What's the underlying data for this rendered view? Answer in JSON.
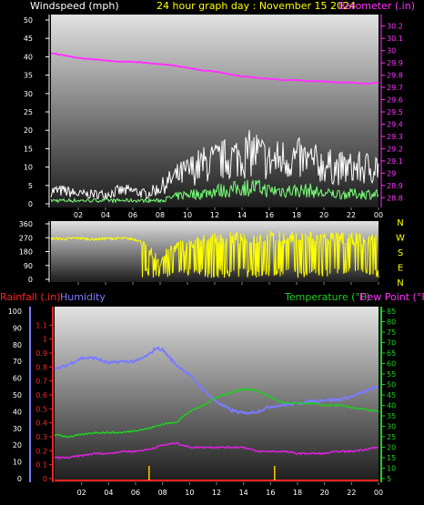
{
  "header": {
    "wind_label": "Windspeed (mph)",
    "title": "24 hour graph day : November 15 2024",
    "baro_label": "Barometer (.in)"
  },
  "colors": {
    "background": "#000000",
    "wind_label": "#ffffff",
    "title": "#ffff00",
    "baro": "#ff33ff",
    "wind_gust": "#ffffff",
    "wind_avg": "#77ff77",
    "direction": "#ffff00",
    "rain": "#ff2222",
    "humidity": "#7b7bff",
    "temperature": "#22cc22",
    "dewpoint": "#dd22dd",
    "rain_bar": "#ffcc00",
    "tick_x": "#5f8fb0"
  },
  "chart_data": [
    {
      "type": "line",
      "title": "24 hour graph day : November 15 2024",
      "xlabel": "",
      "x_tick_labels": [
        "02",
        "04",
        "06",
        "08",
        "10",
        "12",
        "14",
        "16",
        "18",
        "20",
        "22",
        "00"
      ],
      "x_range_hours": [
        0,
        24
      ],
      "y_left": {
        "label": "Windspeed (mph)",
        "range": [
          0,
          50
        ],
        "ticks": [
          "0",
          "5",
          "10",
          "15",
          "20",
          "25",
          "30",
          "35",
          "40",
          "45",
          "50"
        ]
      },
      "y_right": {
        "label": "Barometer (.in)",
        "range": [
          28.75,
          30.25
        ],
        "ticks": [
          "28.8",
          "28.9",
          "29",
          "29.1",
          "29.2",
          "29.3",
          "29.4",
          "29.5",
          "29.6",
          "29.7",
          "29.8",
          "29.9",
          "30",
          "30.1",
          "30.2"
        ]
      },
      "series": [
        {
          "name": "Barometer",
          "axis": "right",
          "x": [
            0,
            1,
            2,
            3,
            4,
            5,
            6,
            7,
            8,
            9,
            10,
            11,
            12,
            13,
            14,
            15,
            16,
            17,
            18,
            19,
            20,
            21,
            22,
            23,
            24
          ],
          "values": [
            29.98,
            29.96,
            29.94,
            29.93,
            29.92,
            29.91,
            29.91,
            29.9,
            29.89,
            29.88,
            29.86,
            29.84,
            29.83,
            29.81,
            29.79,
            29.78,
            29.77,
            29.76,
            29.76,
            29.75,
            29.75,
            29.74,
            29.74,
            29.73,
            29.74
          ]
        },
        {
          "name": "Gust",
          "axis": "left",
          "x": [
            0,
            1,
            2,
            3,
            4,
            5,
            6,
            7,
            8,
            9,
            10,
            11,
            12,
            13,
            14,
            15,
            16,
            17,
            18,
            19,
            20,
            21,
            22,
            23,
            24
          ],
          "values": [
            4,
            4,
            3,
            3,
            3,
            4,
            4,
            3,
            5,
            8,
            10,
            12,
            13,
            14,
            15,
            16,
            13,
            14,
            14,
            13,
            12,
            11,
            11,
            11,
            12
          ]
        },
        {
          "name": "Wind",
          "axis": "left",
          "x": [
            0,
            1,
            2,
            3,
            4,
            5,
            6,
            7,
            8,
            9,
            10,
            11,
            12,
            13,
            14,
            15,
            16,
            17,
            18,
            19,
            20,
            21,
            22,
            23,
            24
          ],
          "values": [
            1,
            1,
            1,
            1,
            1,
            1,
            1,
            1,
            1,
            2,
            3,
            3,
            4,
            4,
            5,
            5,
            4,
            4,
            4,
            4,
            3,
            3,
            3,
            3,
            3
          ]
        }
      ]
    },
    {
      "type": "scatter",
      "y_left_ticks": [
        "0",
        "90",
        "180",
        "270",
        "360"
      ],
      "y_right_letters": [
        "N",
        "W",
        "S",
        "E",
        "N"
      ],
      "y_range": [
        0,
        360
      ],
      "series": [
        {
          "name": "Wind direction",
          "x": [
            0,
            1,
            2,
            3,
            4,
            5,
            6,
            6.5,
            7,
            8,
            9,
            10,
            11,
            12,
            13,
            14,
            15,
            16,
            17,
            18,
            19,
            20,
            21,
            22,
            23,
            24
          ],
          "values": [
            265,
            262,
            268,
            260,
            264,
            266,
            262,
            250,
            180,
            120,
            210,
            230,
            250,
            260,
            270,
            265,
            268,
            270,
            275,
            272,
            275,
            270,
            268,
            265,
            262,
            260
          ]
        }
      ]
    },
    {
      "type": "line",
      "header_labels": {
        "rain": "Rainfall (.in)",
        "humidity": "Humidity",
        "temperature": "Temperature (°F)",
        "dewpoint": "Dew Point (°F)"
      },
      "x_tick_labels": [
        "02",
        "04",
        "06",
        "08",
        "10",
        "12",
        "14",
        "16",
        "18",
        "20",
        "22",
        "00"
      ],
      "x_range_hours": [
        0,
        24
      ],
      "humidity_axis": {
        "range": [
          0,
          100
        ],
        "ticks": [
          "0",
          "10",
          "20",
          "30",
          "40",
          "50",
          "60",
          "70",
          "80",
          "90",
          "100"
        ]
      },
      "rain_axis": {
        "range": [
          0,
          1.2
        ],
        "ticks": [
          "0",
          "0.1",
          "0.2",
          "0.3",
          "0.4",
          "0.5",
          "0.6",
          "0.7",
          "0.8",
          "0.9",
          "1",
          "1.1"
        ]
      },
      "temp_axis": {
        "range": [
          5,
          85
        ],
        "ticks": [
          "5",
          "10",
          "15",
          "20",
          "25",
          "30",
          "35",
          "40",
          "45",
          "50",
          "55",
          "60",
          "65",
          "70",
          "75",
          "80",
          "85"
        ]
      },
      "series": [
        {
          "name": "Humidity",
          "axis": "humidity",
          "x": [
            0,
            1,
            2,
            3,
            4,
            5,
            6,
            7,
            7.5,
            8,
            9,
            10,
            11,
            12,
            13,
            14,
            15,
            16,
            17,
            18,
            19,
            20,
            21,
            22,
            23,
            24
          ],
          "values": [
            65,
            68,
            72,
            72,
            69,
            70,
            70,
            74,
            78,
            77,
            68,
            62,
            53,
            46,
            41,
            39,
            40,
            43,
            44,
            45,
            46,
            47,
            47,
            49,
            52,
            55
          ]
        },
        {
          "name": "Temperature",
          "axis": "temp",
          "x": [
            0,
            1,
            2,
            3,
            4,
            5,
            6,
            7,
            8,
            9,
            10,
            11,
            12,
            13,
            14,
            15,
            16,
            17,
            18,
            19,
            20,
            21,
            22,
            23,
            24
          ],
          "values": [
            26,
            25,
            26,
            27,
            27,
            27,
            28,
            29,
            31,
            32,
            37,
            40,
            44,
            46,
            48,
            47,
            44,
            41,
            41,
            41,
            40,
            40,
            39,
            38,
            37
          ]
        },
        {
          "name": "Dew Point",
          "axis": "temp",
          "x": [
            0,
            1,
            2,
            3,
            4,
            5,
            6,
            7,
            8,
            9,
            10,
            11,
            12,
            13,
            14,
            15,
            16,
            17,
            18,
            19,
            20,
            21,
            22,
            23,
            24
          ],
          "values": [
            15,
            15,
            16,
            17,
            17,
            18,
            18,
            19,
            21,
            22,
            20,
            20,
            20,
            20,
            20,
            18,
            18,
            18,
            17,
            17,
            17,
            18,
            18,
            19,
            20
          ]
        },
        {
          "name": "Rainfall",
          "axis": "rain",
          "x": [
            0,
            24
          ],
          "values": [
            0,
            0
          ]
        }
      ],
      "rain_ticks_hours": [
        7.0,
        16.3
      ]
    }
  ]
}
